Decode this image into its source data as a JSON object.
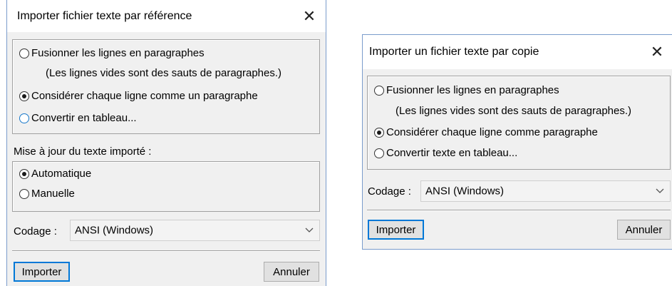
{
  "dialog1": {
    "title": "Importer fichier texte par référence",
    "options": [
      {
        "label": "Fusionner les lignes en paragraphes",
        "selected": false
      },
      {
        "label": "Considérer chaque ligne comme un paragraphe",
        "selected": true
      },
      {
        "label": "Convertir en tableau...",
        "selected": false
      }
    ],
    "merge_note": "(Les lignes vides sont des sauts de paragraphes.)",
    "update_label": "Mise à jour du texte importé :",
    "update_options": [
      {
        "label": "Automatique",
        "selected": true
      },
      {
        "label": "Manuelle",
        "selected": false
      }
    ],
    "encoding_label": "Codage :",
    "encoding_value": "ANSI (Windows)",
    "import_button": "Importer",
    "cancel_button": "Annuler"
  },
  "dialog2": {
    "title": "Importer un fichier texte par copie",
    "options": [
      {
        "label": "Fusionner les lignes en paragraphes",
        "selected": false
      },
      {
        "label": "Considérer chaque ligne comme paragraphe",
        "selected": true
      },
      {
        "label": "Convertir texte en tableau...",
        "selected": false
      }
    ],
    "merge_note": "(Les lignes vides sont des sauts de paragraphes.)",
    "encoding_label": "Codage :",
    "encoding_value": "ANSI (Windows)",
    "import_button": "Importer",
    "cancel_button": "Annuler"
  },
  "icons": {
    "close": "close-icon",
    "dropdown": "chevron-down-icon",
    "radio": "radio-button"
  },
  "colors": {
    "accent": "#0078d7",
    "dialog_bg": "#f0f0f0",
    "focus_radio": "#1979ca"
  }
}
